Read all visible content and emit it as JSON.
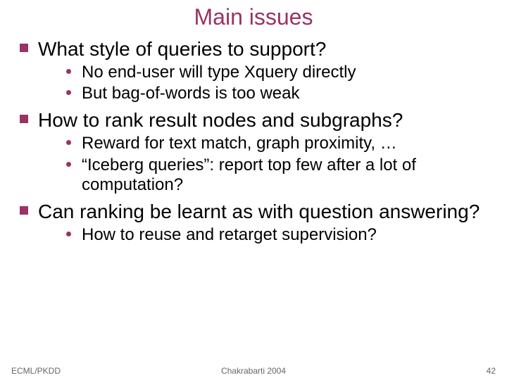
{
  "title": "Main issues",
  "sections": [
    {
      "heading": "What style of queries to support?",
      "points": [
        "No end-user will type Xquery directly",
        "But bag-of-words is too weak"
      ]
    },
    {
      "heading": "How to rank result nodes and subgraphs?",
      "points": [
        "Reward for text match, graph proximity, …",
        "“Iceberg queries”: report top few after a lot of computation?"
      ]
    },
    {
      "heading": "Can ranking be learnt as with question answering?",
      "points": [
        "How to reuse and retarget supervision?"
      ]
    }
  ],
  "footer": {
    "left": "ECML/PKDD",
    "center": "Chakrabarti 2004",
    "right": "42"
  }
}
